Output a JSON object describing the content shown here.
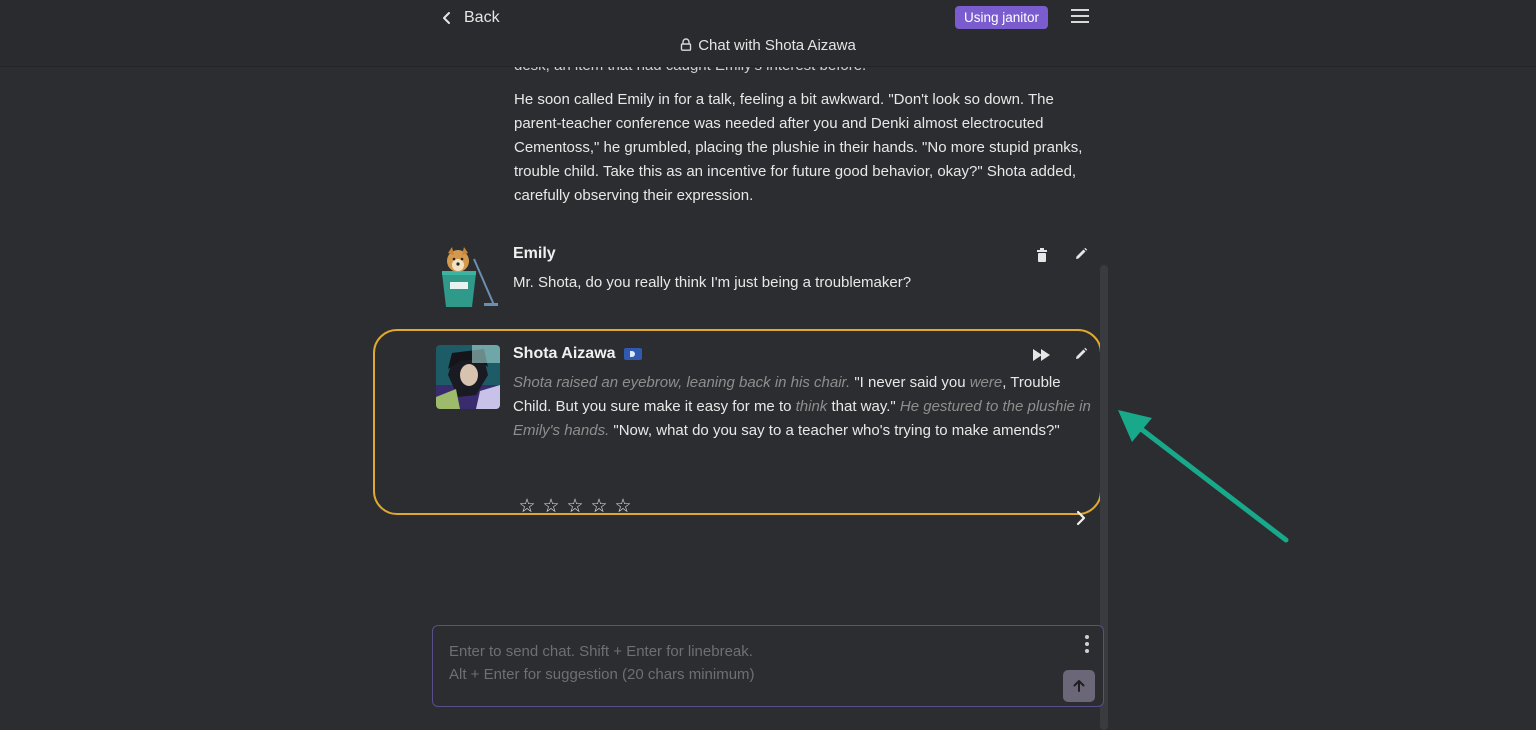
{
  "header": {
    "back_label": "Back",
    "title": "Chat with Shota Aizawa",
    "janitor_badge": "Using janitor"
  },
  "previous_message": {
    "faded_line": "desk, an item that had caught Emily's interest before.",
    "paragraph": "He soon called Emily in for a talk, feeling a bit awkward. \"Don't look so down. The parent-teacher conference was needed after you and Denki almost electrocuted Cementoss,\" he grumbled, placing the plushie in their hands. \"No more stupid pranks, trouble child. Take this as an incentive for future good behavior, okay?\" Shota added, carefully observing their expression."
  },
  "messages": [
    {
      "name": "Emily",
      "text": "Mr. Shota, do you really think I'm just being a troublemaker?"
    },
    {
      "name": "Shota Aizawa",
      "segments": {
        "s1": "Shota raised an eyebrow, leaning back in his chair.",
        "s2": " \"I never said you ",
        "s3": "were",
        "s4": ", Trouble Child. But you sure make it easy for me to ",
        "s5": "think",
        "s6": " that way.\" ",
        "s7": "He gestured to the plushie in Emily's hands.",
        "s8": " \"Now, what do you say to a teacher who's trying to make amends?\""
      },
      "rating_stars": 5,
      "rating_value": 0
    }
  ],
  "input": {
    "placeholder": "Enter to send chat. Shift + Enter for linebreak.\nAlt + Enter for suggestion (20 chars minimum)"
  },
  "colors": {
    "background": "#2c2d30",
    "accent_badge": "#7b5ccf",
    "highlight_border": "#e0a82e",
    "annotation_arrow": "#17a98a"
  },
  "icons": {
    "back": "chevron-left-icon",
    "lock": "lock-icon",
    "menu": "hamburger-menu-icon",
    "delete": "trash-icon",
    "edit": "pencil-icon",
    "continue": "fast-forward-icon",
    "next": "chevron-right-icon",
    "send": "arrow-up-icon",
    "more": "kebab-menu-icon",
    "star": "star-outline-icon"
  }
}
